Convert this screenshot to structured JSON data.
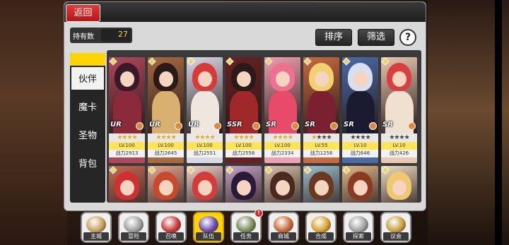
{
  "header": {
    "back_label": "返回"
  },
  "owned": {
    "label": "持有数",
    "value": "27"
  },
  "toolbar": {
    "sort_label": "排序",
    "filter_label": "筛选",
    "help_label": "?"
  },
  "sidebar": {
    "items": [
      {
        "label": "伙伴",
        "active": true
      },
      {
        "label": "魔卡",
        "active": false
      },
      {
        "label": "圣物",
        "active": false
      },
      {
        "label": "背包",
        "active": false
      }
    ]
  },
  "cards": [
    {
      "rarity": "UR",
      "stars": 4,
      "max_stars": 4,
      "level": "LV.100",
      "power": "战力2913",
      "hair": "#3a1a2a",
      "outfit": "#8a2a3a",
      "bg": "#b0485a"
    },
    {
      "rarity": "UR",
      "stars": 4,
      "max_stars": 4,
      "level": "LV.100",
      "power": "战力2645",
      "hair": "#2a1a18",
      "outfit": "#d8b070",
      "bg": "#a86a40"
    },
    {
      "rarity": "UR",
      "stars": 4,
      "max_stars": 4,
      "level": "LV.100",
      "power": "战力2551",
      "hair": "#d83a3a",
      "outfit": "#f0e6e0",
      "bg": "#d8d8e8"
    },
    {
      "rarity": "SSR",
      "stars": 4,
      "max_stars": 4,
      "level": "LV.100",
      "power": "战力2556",
      "hair": "#2a1a1a",
      "outfit": "#a02828",
      "bg": "#6a2020"
    },
    {
      "rarity": "SR",
      "stars": 4,
      "max_stars": 4,
      "level": "LV.100",
      "power": "战力2334",
      "hair": "#f07090",
      "outfit": "#e84a6a",
      "bg": "#f0a0b0"
    },
    {
      "rarity": "SR",
      "stars": 1,
      "max_stars": 4,
      "level": "LV.55",
      "power": "战力1256",
      "hair": "#f0d070",
      "outfit": "#7a2030",
      "bg": "#c86a40"
    },
    {
      "rarity": "SR",
      "stars": 0,
      "max_stars": 4,
      "level": "LV.10",
      "power": "战力646",
      "hair": "#d8e0f0",
      "outfit": "#1a1a30",
      "bg": "#4a6aa8"
    },
    {
      "rarity": "SR",
      "stars": 0,
      "max_stars": 4,
      "level": "LV.10",
      "power": "战力426",
      "hair": "#d84040",
      "outfit": "#f0e0d0",
      "bg": "#e8c8b0"
    }
  ],
  "cards_row2": [
    {
      "hair": "#d03030",
      "bg": "#c86a50"
    },
    {
      "hair": "#c84a2a",
      "bg": "#e8a890"
    },
    {
      "hair": "#d83a3a",
      "bg": "#f0d0c8"
    },
    {
      "hair": "#2a1a3a",
      "bg": "#c8a0c8"
    },
    {
      "hair": "#4a2a20",
      "bg": "#d8c0a8"
    },
    {
      "hair": "#6a3a20",
      "bg": "#9ac0d0"
    },
    {
      "hair": "#8a3a20",
      "bg": "#e0b888"
    },
    {
      "hair": "#f0c870",
      "bg": "#f0e0c0"
    }
  ],
  "nav": [
    {
      "label": "主城",
      "icon": "castle-icon",
      "color": "#c8a060",
      "active": false,
      "badge": ""
    },
    {
      "label": "冒险",
      "icon": "crossed-swords-icon",
      "color": "#a0a0a0",
      "active": false,
      "badge": ""
    },
    {
      "label": "召唤",
      "icon": "summon-icon",
      "color": "#c83a3a",
      "active": false,
      "badge": ""
    },
    {
      "label": "队伍",
      "icon": "team-shield-icon",
      "color": "#6a4ab0",
      "active": true,
      "badge": ""
    },
    {
      "label": "任务",
      "icon": "scroll-icon",
      "color": "#7a8a5a",
      "active": false,
      "badge": "!"
    },
    {
      "label": "商城",
      "icon": "shop-icon",
      "color": "#c86a3a",
      "active": false,
      "badge": ""
    },
    {
      "label": "合成",
      "icon": "crystal-icon",
      "color": "#d8a030",
      "active": false,
      "badge": ""
    },
    {
      "label": "探索",
      "icon": "compass-icon",
      "color": "#a0a0a0",
      "active": false,
      "badge": ""
    },
    {
      "label": "议会",
      "icon": "crown-icon",
      "color": "#c8a040",
      "active": false,
      "badge": ""
    }
  ]
}
